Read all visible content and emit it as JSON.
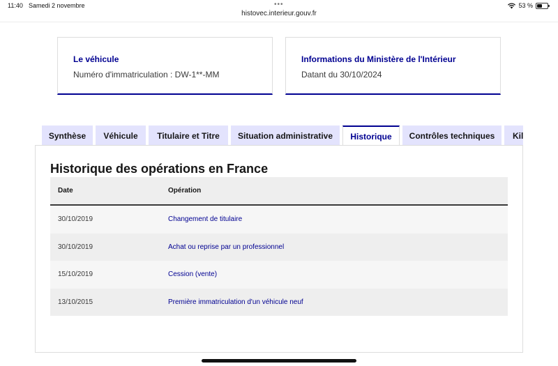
{
  "status": {
    "time": "11:40",
    "date": "Samedi 2 novembre",
    "battery": "53 %",
    "battery_level": 0.53,
    "url": "histovec.interieur.gouv.fr"
  },
  "cards": {
    "vehicle": {
      "title": "Le véhicule",
      "text": "Numéro d'immatriculation : DW-1**-MM"
    },
    "ministry": {
      "title": "Informations du Ministère de l'Intérieur",
      "text": "Datant du 30/10/2024"
    }
  },
  "tabs": [
    {
      "label": "Synthèse",
      "active": false
    },
    {
      "label": "Véhicule",
      "active": false
    },
    {
      "label": "Titulaire et Titre",
      "active": false
    },
    {
      "label": "Situation administrative",
      "active": false
    },
    {
      "label": "Historique",
      "active": true
    },
    {
      "label": "Contrôles techniques",
      "active": false
    },
    {
      "label": "Kil",
      "active": false
    }
  ],
  "history": {
    "title": "Historique des opérations en France",
    "columns": {
      "date": "Date",
      "operation": "Opération"
    },
    "rows": [
      {
        "date": "30/10/2019",
        "operation": "Changement de titulaire"
      },
      {
        "date": "30/10/2019",
        "operation": "Achat ou reprise par un professionnel"
      },
      {
        "date": "15/10/2019",
        "operation": "Cession (vente)"
      },
      {
        "date": "13/10/2015",
        "operation": "Première immatriculation d'un véhicule neuf"
      }
    ]
  },
  "colors": {
    "accent": "#000091",
    "tab_bg": "#e3e3fd"
  }
}
